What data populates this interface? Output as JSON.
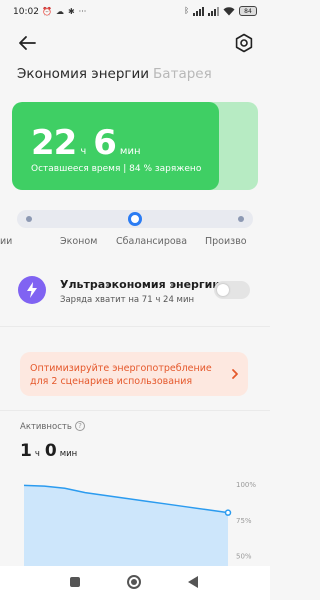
{
  "status_bar": {
    "time": "10:02",
    "left_icons": [
      "alarm-icon",
      "cloud-icon",
      "settings-icon",
      "more-icon"
    ],
    "right_icons": [
      "bluetooth-icon",
      "signal-icon",
      "signal-icon",
      "wifi-icon"
    ],
    "battery_level": "84"
  },
  "header": {
    "tabs": [
      "Экономия энергии",
      "Батарея"
    ]
  },
  "battery_card": {
    "hours": "22",
    "hours_unit": "ч",
    "minutes": "6",
    "minutes_unit": "мин",
    "subtitle": "Оставшееся время | 84 % заряжено",
    "charge_fraction": 0.84,
    "color": "#3fcf64"
  },
  "modes": {
    "labels": [
      "ии",
      "Эконом",
      "Сбалансирова",
      "Произво"
    ],
    "selected_index": 2,
    "accent": "#2b7cf3"
  },
  "ultra_saver": {
    "title": "Ультраэкономия энергии",
    "subtitle": "Заряда хватит на 71 ч 24 мин",
    "enabled": false
  },
  "optimize": {
    "text": "Оптимизируйте энергопотребление для 2 сценариев использования"
  },
  "activity": {
    "label": "Активность",
    "hours": "1",
    "hours_unit": "ч",
    "minutes": "0",
    "minutes_unit": "мин"
  },
  "chart_data": {
    "type": "area",
    "y_ticks": [
      "100%",
      "75%",
      "50%"
    ],
    "ylim": [
      40,
      100
    ],
    "x": [
      0,
      1,
      2,
      3,
      4,
      5,
      6,
      7,
      8,
      9,
      10
    ],
    "values": [
      99,
      98.5,
      97,
      94,
      92,
      90,
      88,
      86,
      84,
      82,
      80
    ],
    "color": "#2b9bef"
  }
}
